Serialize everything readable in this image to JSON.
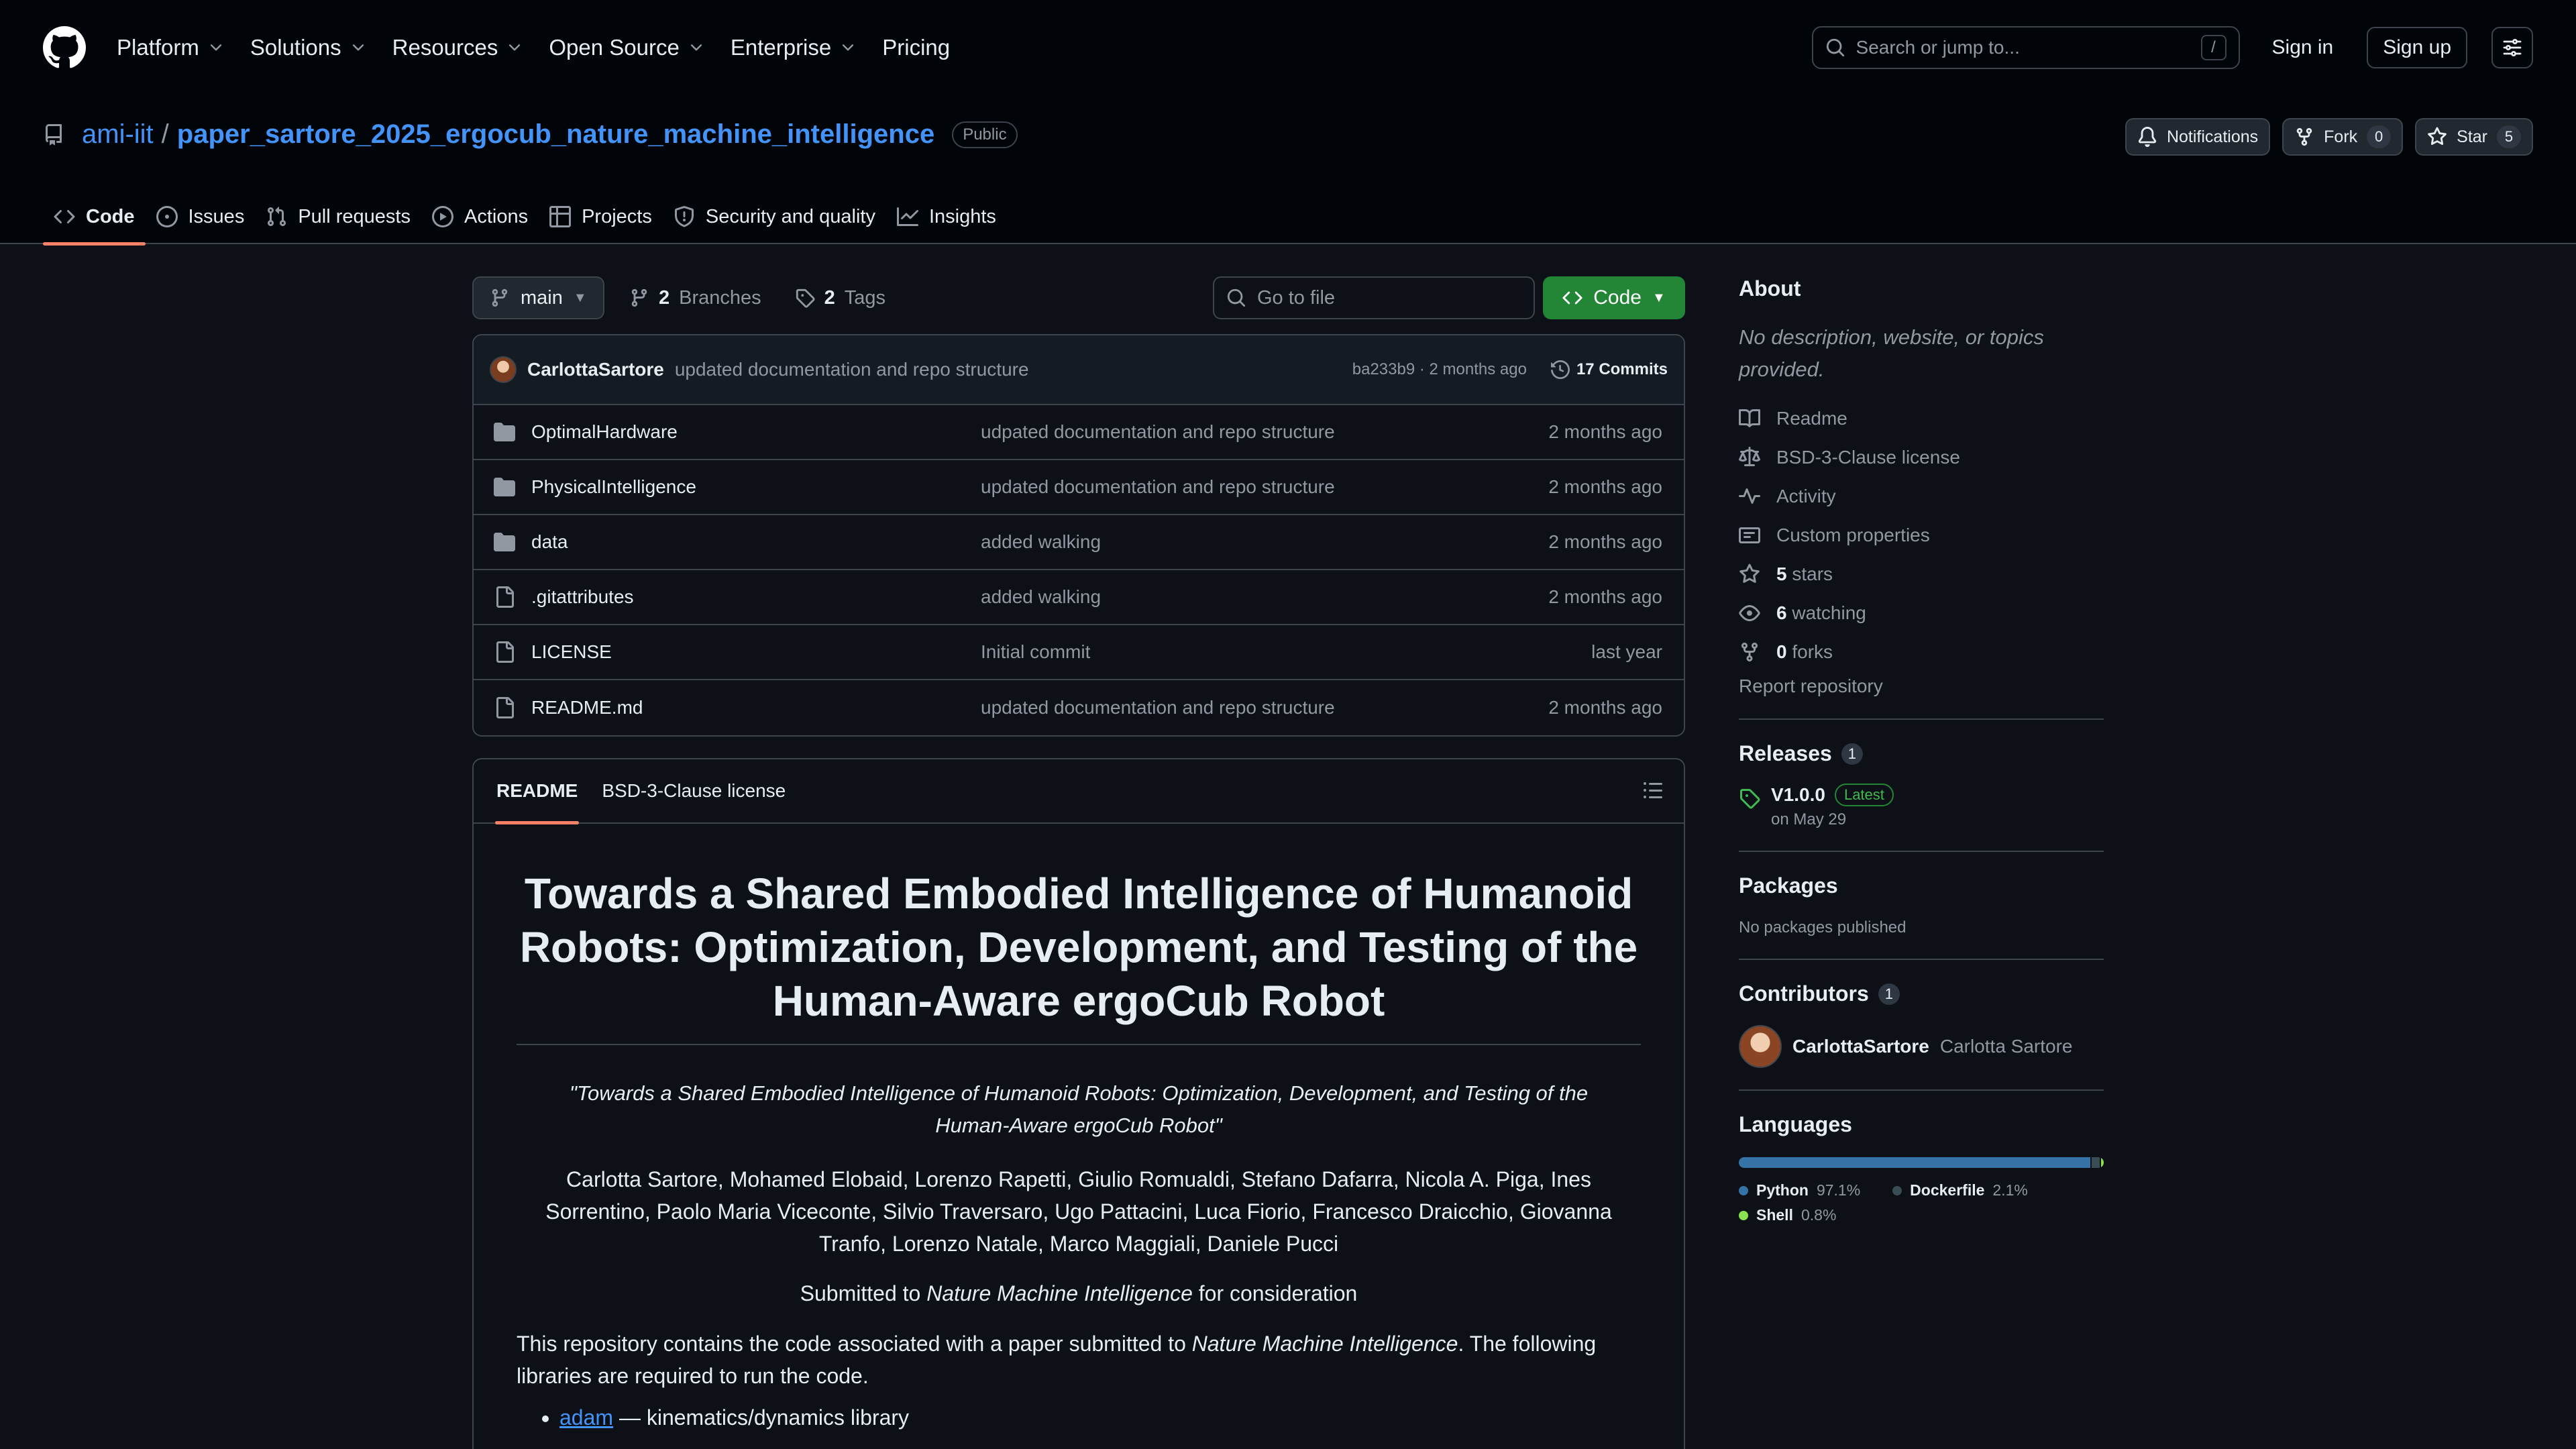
{
  "header": {
    "nav": [
      {
        "label": "Platform",
        "dropdown": true
      },
      {
        "label": "Solutions",
        "dropdown": true
      },
      {
        "label": "Resources",
        "dropdown": true
      },
      {
        "label": "Open Source",
        "dropdown": true
      },
      {
        "label": "Enterprise",
        "dropdown": true
      },
      {
        "label": "Pricing",
        "dropdown": false
      }
    ],
    "search_placeholder": "Search or jump to...",
    "search_shortcut": "/",
    "sign_in": "Sign in",
    "sign_up": "Sign up"
  },
  "repo": {
    "owner": "ami-iit",
    "separator": "/",
    "name": "paper_sartore_2025_ergocub_nature_machine_intelligence",
    "visibility": "Public",
    "notifications_label": "Notifications",
    "fork_label": "Fork",
    "fork_count": "0",
    "star_label": "Star",
    "star_count": "5",
    "tabs": [
      {
        "label": "Code",
        "icon": "code-icon",
        "active": true
      },
      {
        "label": "Issues",
        "icon": "issue-opened-icon",
        "active": false
      },
      {
        "label": "Pull requests",
        "icon": "git-pull-request-icon",
        "active": false
      },
      {
        "label": "Actions",
        "icon": "play-icon",
        "active": false
      },
      {
        "label": "Projects",
        "icon": "table-icon",
        "active": false
      },
      {
        "label": "Security and quality",
        "icon": "shield-icon",
        "active": false
      },
      {
        "label": "Insights",
        "icon": "graph-icon",
        "active": false
      }
    ]
  },
  "toolbar": {
    "branch": "main",
    "branches_count": "2",
    "branches_label": "Branches",
    "tags_count": "2",
    "tags_label": "Tags",
    "goto_placeholder": "Go to file",
    "code_label": "Code"
  },
  "commit": {
    "author": "CarlottaSartore",
    "message": "updated documentation and repo structure",
    "meta": "ba233b9 · 2 months ago",
    "count_label": "17 Commits"
  },
  "files": [
    {
      "name": "OptimalHardware",
      "type": "folder",
      "message": "udpated documentation and repo structure",
      "date": "2 months ago"
    },
    {
      "name": "PhysicalIntelligence",
      "type": "folder",
      "message": "updated documentation and repo structure",
      "date": "2 months ago"
    },
    {
      "name": "data",
      "type": "folder",
      "message": "added walking",
      "date": "2 months ago"
    },
    {
      "name": ".gitattributes",
      "type": "file",
      "message": "added walking",
      "date": "2 months ago"
    },
    {
      "name": "LICENSE",
      "type": "file",
      "message": "Initial commit",
      "date": "last year"
    },
    {
      "name": "README.md",
      "type": "file",
      "message": "updated documentation and repo structure",
      "date": "2 months ago"
    }
  ],
  "readme": {
    "tabs": [
      "README",
      "BSD-3-Clause license"
    ],
    "title": "Towards a Shared Embodied Intelligence of Humanoid Robots: Optimization, Development, and Testing of the Human-Aware ergoCub Robot",
    "quote": "\"Towards a Shared Embodied Intelligence of Humanoid Robots: Optimization, Development, and Testing of the Human-Aware ergoCub Robot\"",
    "authors": "Carlotta Sartore, Mohamed Elobaid, Lorenzo Rapetti, Giulio Romualdi, Stefano Dafarra, Nicola A. Piga, Ines Sorrentino, Paolo Maria Viceconte, Silvio Traversaro, Ugo Pattacini, Luca Fiorio, Francesco Draicchio, Giovanna Tranfo, Lorenzo Natale, Marco Maggiali, Daniele Pucci",
    "submitted_prefix": "Submitted to ",
    "submitted_journal": "Nature Machine Intelligence",
    "submitted_suffix": " for consideration",
    "para_prefix": "This repository contains the code associated with a paper submitted to ",
    "para_journal": "Nature Machine Intelligence",
    "para_suffix": ". The following libraries are required to run the code.",
    "list": [
      {
        "link": "adam",
        "text": " — kinematics/dynamics library"
      }
    ]
  },
  "sidebar": {
    "about_title": "About",
    "about_desc": "No description, website, or topics provided.",
    "about_items": [
      {
        "icon": "book-icon",
        "bold": "",
        "text": "Readme"
      },
      {
        "icon": "law-icon",
        "bold": "",
        "text": "BSD-3-Clause license"
      },
      {
        "icon": "pulse-icon",
        "bold": "",
        "text": "Activity"
      },
      {
        "icon": "note-icon",
        "bold": "",
        "text": "Custom properties"
      },
      {
        "icon": "star-icon",
        "bold": "5",
        "text": " stars"
      },
      {
        "icon": "eye-icon",
        "bold": "6",
        "text": " watching"
      },
      {
        "icon": "repo-forked-icon",
        "bold": "0",
        "text": " forks"
      }
    ],
    "report": "Report repository",
    "releases_title": "Releases",
    "releases_count": "1",
    "release_name": "V1.0.0",
    "release_badge": "Latest",
    "release_date": "on May 29",
    "packages_title": "Packages",
    "packages_empty": "No packages published",
    "contributors_title": "Contributors",
    "contributors_count": "1",
    "contributor_login": "CarlottaSartore",
    "contributor_name": "Carlotta Sartore",
    "languages_title": "Languages",
    "languages": [
      {
        "name": "Python",
        "percent": "97.1%",
        "value": 97.1,
        "color": "#3572A5"
      },
      {
        "name": "Dockerfile",
        "percent": "2.1%",
        "value": 2.1,
        "color": "#384d54"
      },
      {
        "name": "Shell",
        "percent": "0.8%",
        "value": 0.8,
        "color": "#89e051"
      }
    ]
  }
}
